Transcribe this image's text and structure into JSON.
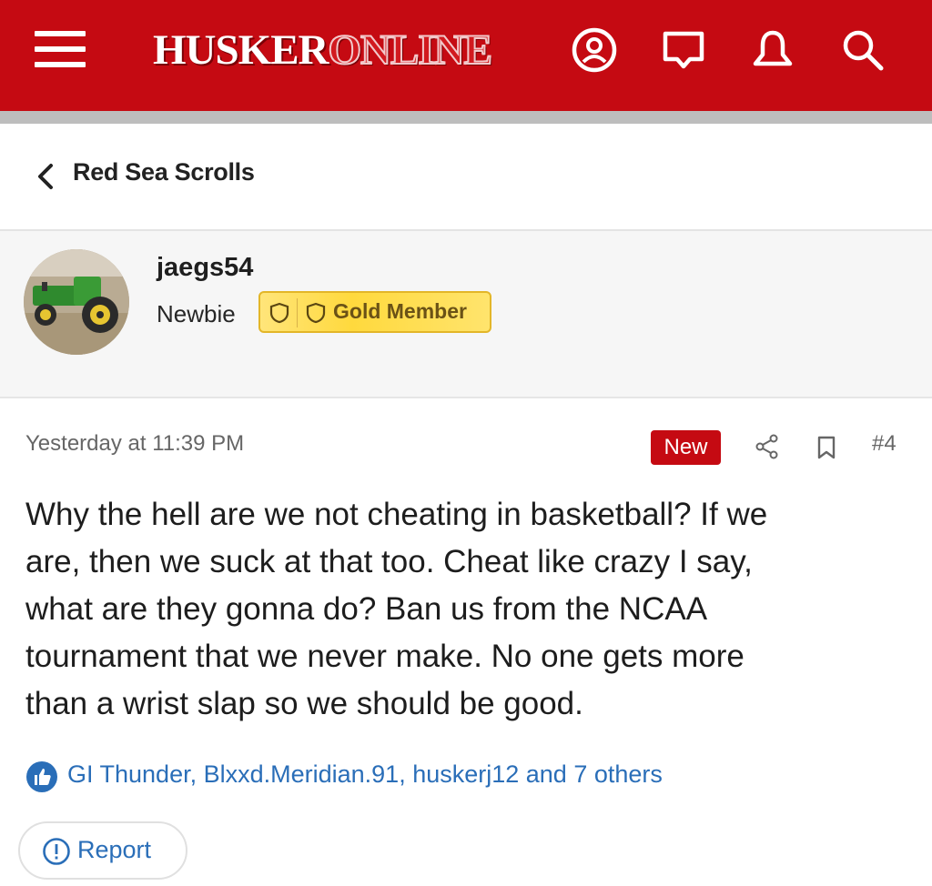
{
  "header": {
    "logo_part1": "HUSKER",
    "logo_part2": "ONLINE",
    "background_color": "#c50a12",
    "icons": [
      "menu-icon",
      "account-icon",
      "messages-icon",
      "notifications-icon",
      "search-icon"
    ]
  },
  "breadcrumb": {
    "label": "Red Sea Scrolls",
    "icon": "chevron-left-icon"
  },
  "author": {
    "username": "jaegs54",
    "title": "Newbie",
    "badge_label": "Gold Member",
    "badge_color": "#ffd93d"
  },
  "post": {
    "timestamp": "Yesterday at 11:39 PM",
    "new_label": "New",
    "post_number": "#4",
    "body_lines": [
      "Why the hell are we not cheating in basketball? If we",
      "are, then we suck at that too. Cheat like crazy I say,",
      "what are they gonna do? Ban us from the NCAA",
      "tournament that we never make. No one gets more",
      "than a wrist slap so we should be good."
    ],
    "likes_text": "GI Thunder, Blxxd.Meridian.91, huskerj12 and 7 others",
    "report_label": "Report"
  },
  "colors": {
    "link": "#2a6eb8",
    "accent": "#c50a12"
  }
}
